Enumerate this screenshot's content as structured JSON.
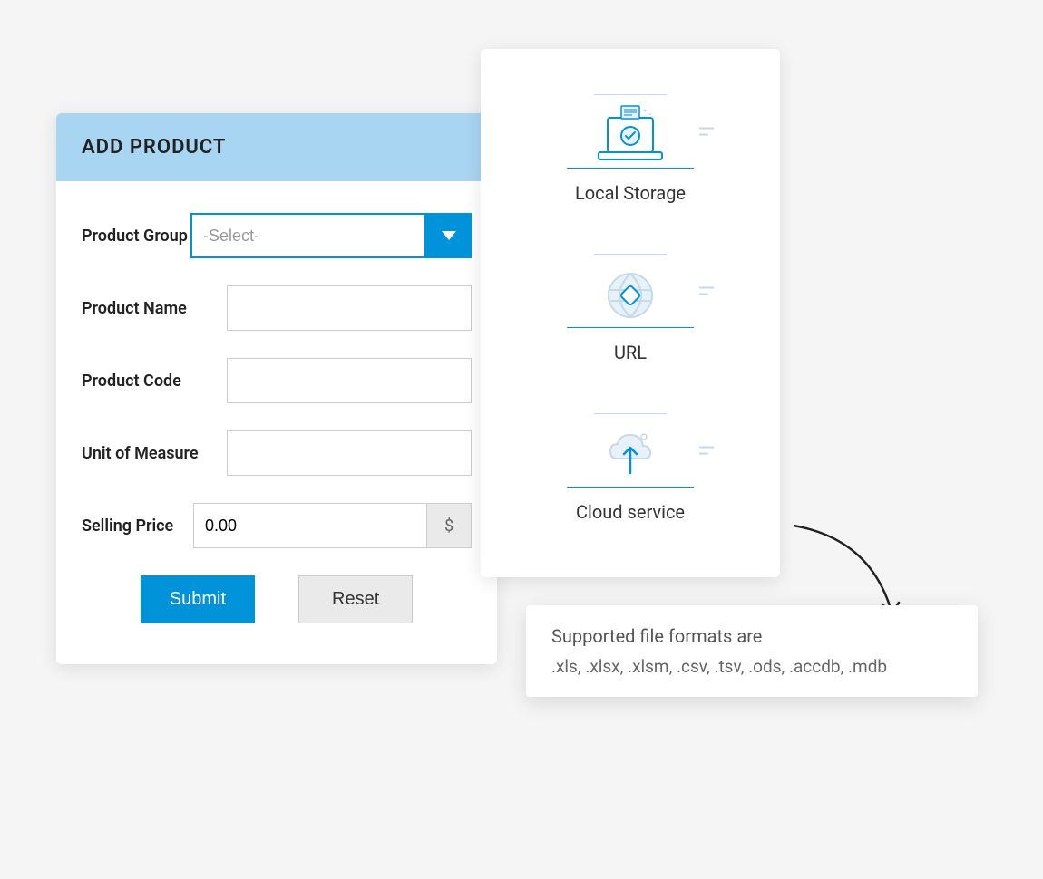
{
  "form": {
    "title": "ADD PRODUCT",
    "fields": {
      "product_group": {
        "label": "Product Group",
        "selected": "-Select-"
      },
      "product_name": {
        "label": "Product Name",
        "value": ""
      },
      "product_code": {
        "label": "Product Code",
        "value": ""
      },
      "unit_of_measure": {
        "label": "Unit of Measure",
        "value": ""
      },
      "selling_price": {
        "label": "Selling Price",
        "value": "0.00",
        "currency": "$"
      }
    },
    "buttons": {
      "submit": "Submit",
      "reset": "Reset"
    }
  },
  "sources": {
    "local_storage": "Local Storage",
    "url": "URL",
    "cloud_service": "Cloud service"
  },
  "tooltip": {
    "title": "Supported file formats are",
    "formats": ".xls, .xlsx, .xlsm, .csv, .tsv, .ods, .accdb, .mdb"
  }
}
